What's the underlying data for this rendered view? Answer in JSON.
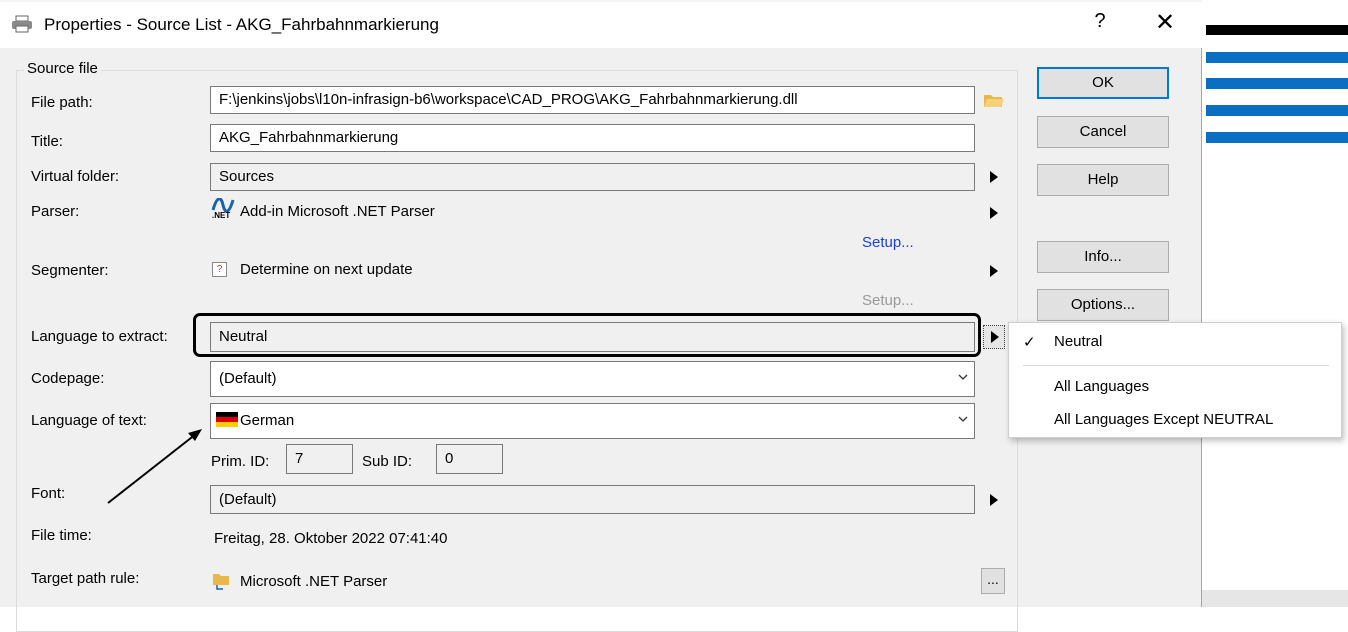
{
  "window": {
    "title": "Properties - Source List - AKG_Fahrbahnmarkierung",
    "help_label": "?",
    "close_label": "✕"
  },
  "group": {
    "caption": "Source file"
  },
  "fields": {
    "file_path": {
      "label": "File path:",
      "value": "F:\\jenkins\\jobs\\l10n-infrasign-b6\\workspace\\CAD_PROG\\AKG_Fahrbahnmarkierung.dll"
    },
    "title": {
      "label": "Title:",
      "value": "AKG_Fahrbahnmarkierung"
    },
    "virtual_folder": {
      "label": "Virtual folder:",
      "value": "Sources"
    },
    "parser": {
      "label": "Parser:",
      "value": "Add-in Microsoft .NET Parser",
      "icon_text": ".NET",
      "setup_label": "Setup..."
    },
    "segmenter": {
      "label": "Segmenter:",
      "value": "Determine on next update",
      "icon_text": "?",
      "setup_label": "Setup..."
    },
    "language_to_extract": {
      "label": "Language to extract:",
      "value": "Neutral"
    },
    "codepage": {
      "label": "Codepage:",
      "value": "(Default)"
    },
    "language_of_text": {
      "label": "Language of text:",
      "value": "German",
      "prim_id_label": "Prim. ID:",
      "prim_id": "7",
      "sub_id_label": "Sub ID:",
      "sub_id": "0"
    },
    "font": {
      "label": "Font:",
      "value": "(Default)"
    },
    "file_time": {
      "label": "File time:",
      "value": "Freitag, 28. Oktober 2022 07:41:40"
    },
    "target_path_rule": {
      "label": "Target path rule:",
      "value": "Microsoft .NET Parser",
      "button_label": "..."
    }
  },
  "buttons": {
    "ok": "OK",
    "cancel": "Cancel",
    "help": "Help",
    "info": "Info...",
    "options": "Options..."
  },
  "language_menu": {
    "items": [
      {
        "label": "Neutral",
        "checked": true
      },
      {
        "label": "All Languages",
        "checked": false
      },
      {
        "label": "All Languages Except NEUTRAL",
        "checked": false
      }
    ],
    "check_glyph": "✓"
  },
  "colors": {
    "accent": "#0078d7",
    "link": "#1a3fe0",
    "background_bars": "#0a6fc2"
  }
}
